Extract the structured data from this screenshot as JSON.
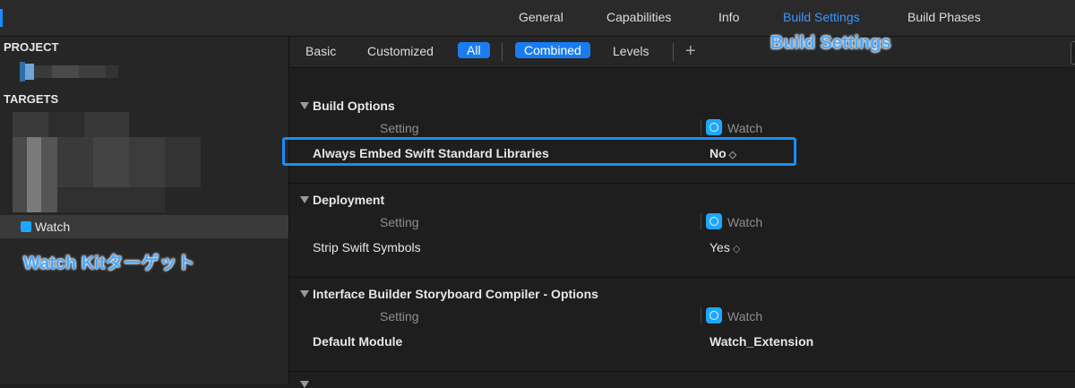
{
  "top_tabs": [
    {
      "label": "General"
    },
    {
      "label": "Capabilities"
    },
    {
      "label": "Info"
    },
    {
      "label": "Build Settings"
    },
    {
      "label": "Build Phases"
    }
  ],
  "sidebar": {
    "project_header": "PROJECT",
    "targets_header": "TARGETS",
    "selected_target": "Watch",
    "annotation": "Watch Kitターゲット"
  },
  "filter_bar": {
    "basic": "Basic",
    "customized": "Customized",
    "all": "All",
    "combined": "Combined",
    "levels": "Levels",
    "add": "+"
  },
  "main_annotation": "Build Settings",
  "sections": [
    {
      "title": "Build Options",
      "col_setting": "Setting",
      "col_target": "Watch",
      "rows": [
        {
          "name": "Always Embed Swift Standard Libraries",
          "value": "No"
        }
      ]
    },
    {
      "title": "Deployment",
      "col_setting": "Setting",
      "col_target": "Watch",
      "rows": [
        {
          "name": "Strip Swift Symbols",
          "value": "Yes"
        }
      ]
    },
    {
      "title": "Interface Builder Storyboard Compiler - Options",
      "col_setting": "Setting",
      "col_target": "Watch",
      "rows": [
        {
          "name": "Default Module",
          "value": "Watch_Extension"
        }
      ]
    }
  ],
  "colors": {
    "accent": "#1a7cf0",
    "annotation": "#4aa8ff",
    "background": "#1e1e1e"
  }
}
